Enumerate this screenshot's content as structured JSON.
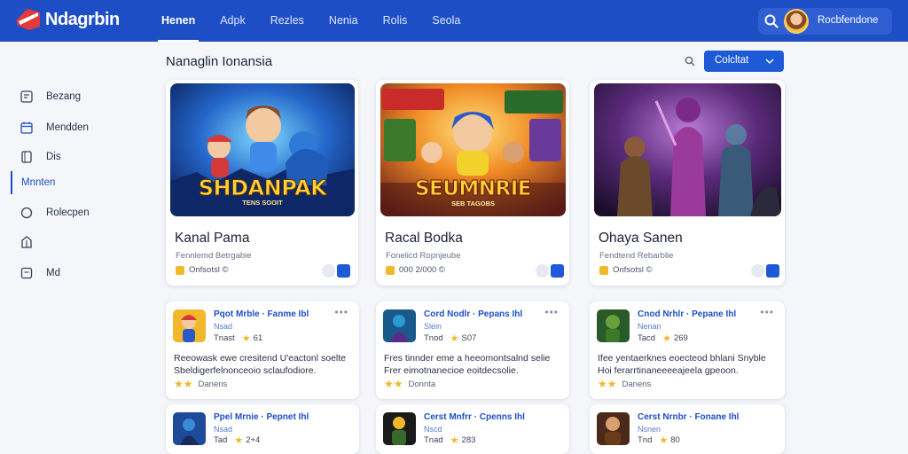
{
  "app": {
    "title": "Ndagrbin"
  },
  "nav": {
    "items": [
      "Henen",
      "Adpk",
      "Rezles",
      "Nenia",
      "Rolis",
      "Seola"
    ]
  },
  "user": {
    "name": "Rocbfendone"
  },
  "sidebar": {
    "items": [
      "Bezang",
      "Mendden",
      "Dis",
      "Mnnten",
      "Rolecpen",
      "Md"
    ]
  },
  "main": {
    "title": "Nanaglin Ionansia",
    "select_label": "Colcltat"
  },
  "featured": [
    {
      "title": "Kanal Pama",
      "subtitle": "Fennlemd Betrgabie",
      "meta": "Onfsotsl ©",
      "banner": "SHDANPAK",
      "banner_sub": "TENS SOOIT"
    },
    {
      "title": "Racal Bodka",
      "subtitle": "Fonelicd Ropnjeube",
      "meta": "000 2/000 ©",
      "banner": "SEUMNRIE",
      "banner_sub": "SEB TAGOBS"
    },
    {
      "title": "Ohaya Sanen",
      "subtitle": "Fendtend Rebarblie",
      "meta": "Onfsotsl ©",
      "banner": "",
      "banner_sub": ""
    }
  ],
  "list": [
    {
      "title": "Pqot Mrble · Fanme Ibl",
      "sub": "Nsad",
      "rate_label": "Tnast",
      "rate": "61",
      "desc": "Reeowask ewe cresitend U'eactonl soelte Sbeldigerfelnonceoio sclaufodiore.",
      "foot": "Danens"
    },
    {
      "title": "Cord Nodlr · Pepans Ihl",
      "sub": "Slein",
      "rate_label": "Tnod",
      "rate": "S07",
      "desc": "Fres tinnder eme a heeomontsalnd selie Frer eimotnanecioe eoitdecsolie.",
      "foot": "Donnta"
    },
    {
      "title": "Cnod Nrhlr · Pepane Ihl",
      "sub": "Nenan",
      "rate_label": "Tacd",
      "rate": "269",
      "desc": "Ifee yentaerknes eoecteod bhlani Snyble Hoi ferarrtinaneeeeajeela gpeoon.",
      "foot": "Danens"
    },
    {
      "title": "Ppel Mrnie · Pepnet Ihl",
      "sub": "Nsad",
      "rate_label": "Tad",
      "rate": "2+4",
      "desc": "",
      "foot": ""
    },
    {
      "title": "Cerst Mnfrr · Cpenns Ihl",
      "sub": "Nscd",
      "rate_label": "Tnad",
      "rate": "283",
      "desc": "",
      "foot": ""
    },
    {
      "title": "Cerst Nrnbr · Fonane Ihl",
      "sub": "Nsnen",
      "rate_label": "Tnd",
      "rate": "80",
      "desc": "",
      "foot": ""
    }
  ],
  "colors": {
    "brand": "#1e4ec6",
    "accent": "#1e5ad6",
    "star": "#f2b82c"
  }
}
